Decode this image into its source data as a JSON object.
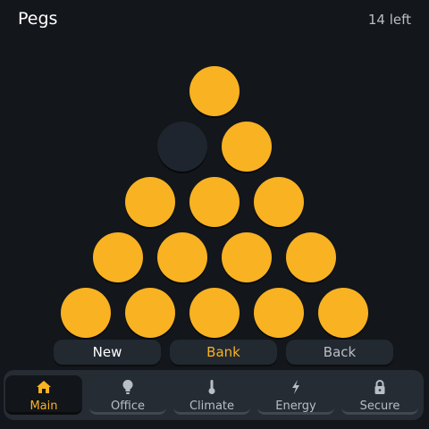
{
  "header": {
    "title": "Pegs",
    "status": "14 left"
  },
  "colors": {
    "peg": "#f8b222",
    "hole": "#1f252e",
    "accent": "#f8b222",
    "background": "#13161b"
  },
  "board": {
    "rows": [
      [
        true
      ],
      [
        false,
        true
      ],
      [
        true,
        true,
        true
      ],
      [
        true,
        true,
        true,
        true
      ],
      [
        true,
        true,
        true,
        true,
        true
      ]
    ]
  },
  "actions": {
    "new_label": "New",
    "bank_label": "Bank",
    "back_label": "Back"
  },
  "nav": {
    "active": "Main",
    "tabs": [
      {
        "label": "Main",
        "icon": "home-icon"
      },
      {
        "label": "Office",
        "icon": "lightbulb-icon"
      },
      {
        "label": "Climate",
        "icon": "thermometer-icon"
      },
      {
        "label": "Energy",
        "icon": "lightning-icon"
      },
      {
        "label": "Secure",
        "icon": "lock-icon"
      }
    ]
  }
}
